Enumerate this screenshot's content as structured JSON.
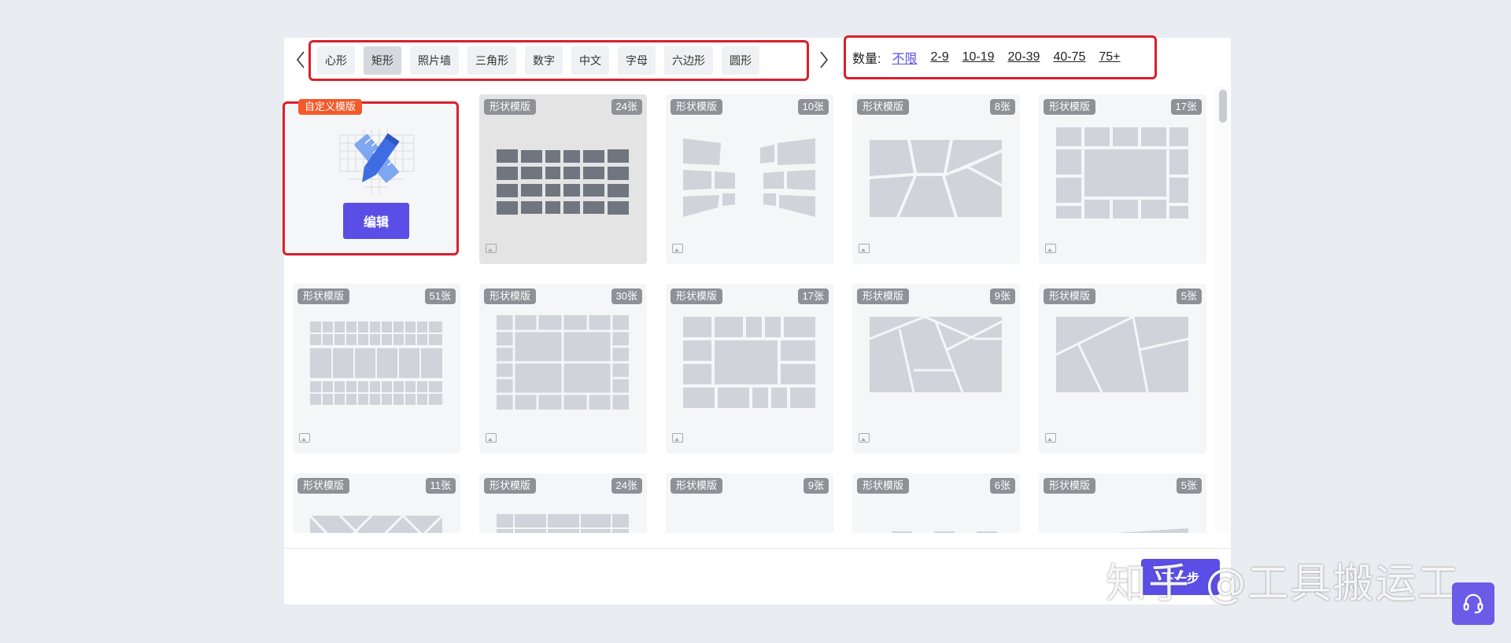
{
  "shape_tabs": [
    "心形",
    "矩形",
    "照片墙",
    "三角形",
    "数字",
    "中文",
    "字母",
    "六边形",
    "圆形"
  ],
  "active_shape_tab": "矩形",
  "count_filter": {
    "label": "数量:",
    "options": [
      "不限",
      "2-9",
      "10-19",
      "20-39",
      "40-75",
      "75+"
    ],
    "active": "不限"
  },
  "custom_card": {
    "tag": "自定义模版",
    "edit_label": "编辑"
  },
  "template_tag": "形状模版",
  "cards": [
    {
      "count": "24张"
    },
    {
      "count": "10张"
    },
    {
      "count": "8张"
    },
    {
      "count": "17张"
    },
    {
      "count": "51张"
    },
    {
      "count": "30张"
    },
    {
      "count": "17张"
    },
    {
      "count": "9张"
    },
    {
      "count": "5张"
    },
    {
      "count": "11张"
    },
    {
      "count": "24张"
    },
    {
      "count": "9张"
    },
    {
      "count": "6张"
    },
    {
      "count": "5张"
    }
  ],
  "footer": {
    "next_label": "下一步",
    "watermark": "知乎 @工具搬运工"
  },
  "colors": {
    "accent": "#5b4ee6",
    "highlight_border": "#d9202a",
    "custom_tag": "#f25a2a",
    "tag_bg": "#8e9196",
    "shape_fill": "#d0d3d9"
  },
  "icons": [
    "chevron-left-icon",
    "chevron-right-icon",
    "pencil-ruler-icon",
    "image-icon",
    "headset-icon"
  ]
}
